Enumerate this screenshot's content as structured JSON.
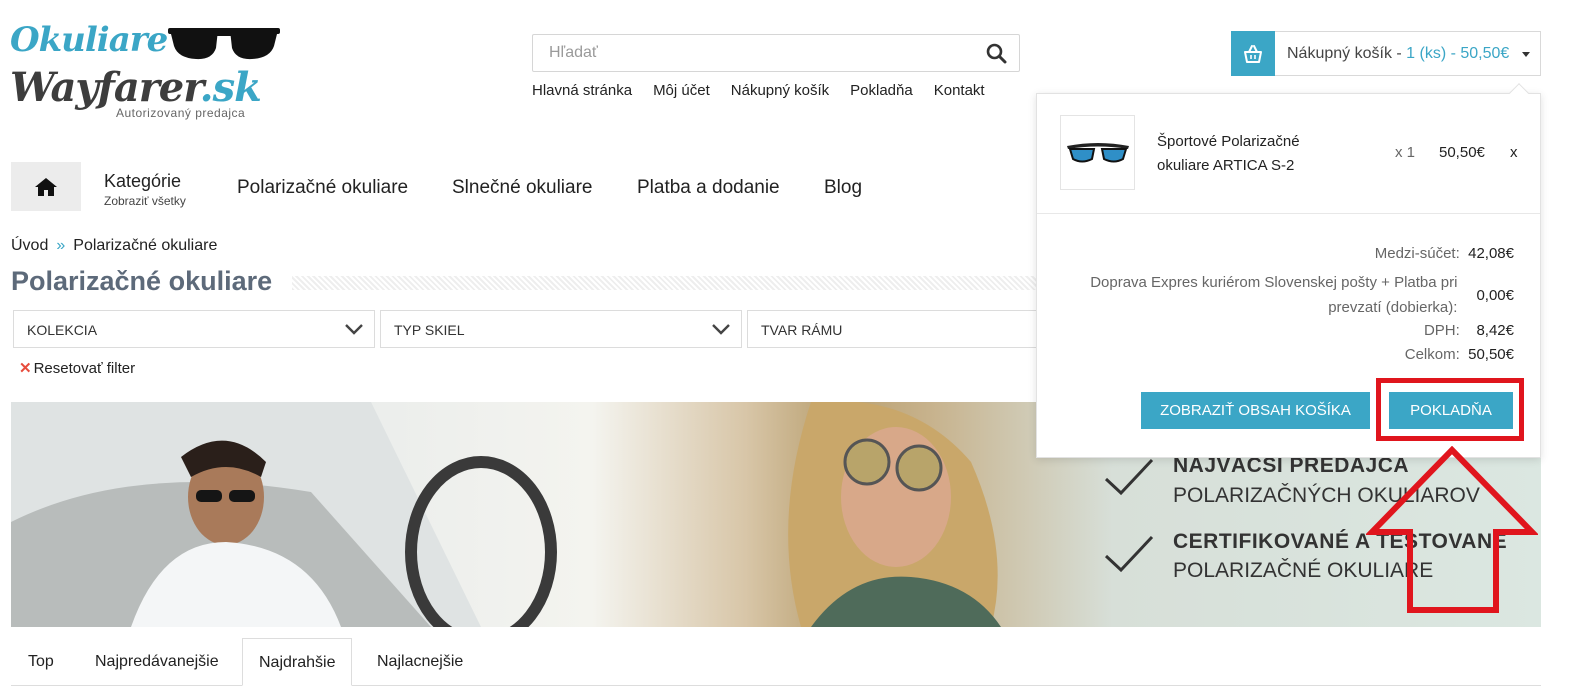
{
  "logo": {
    "line1": "Okuliare",
    "line2_main": "Wayfarer",
    "line2_domain": ".sk",
    "tagline": "Autorizovaný predajca"
  },
  "search": {
    "placeholder": "Hľadať",
    "icon": "search-icon"
  },
  "top_links": [
    "Hlavná stránka",
    "Môj účet",
    "Nákupný košík",
    "Pokladňa",
    "Kontakt"
  ],
  "cart": {
    "label": "Nákupný košík - ",
    "summary": "1 (ks) - 50,50€",
    "icon": "basket-icon"
  },
  "nav": {
    "home_icon": "home-icon",
    "categories_title": "Kategórie",
    "categories_sub": "Zobraziť všetky",
    "items": [
      "Polarizačné okuliare",
      "Slnečné okuliare",
      "Platba a dodanie",
      "Blog"
    ]
  },
  "breadcrumb": {
    "home": "Úvod",
    "separator": "»",
    "current": "Polarizačné okuliare"
  },
  "page_title": "Polarizačné okuliare",
  "filters": [
    "KOLEKCIA",
    "TYP SKIEL",
    "TVAR RÁMU"
  ],
  "reset_filter": "Resetovať filter",
  "banner": {
    "line1": "NAJVÄČŠÍ PREDAJCA",
    "line2": "POLARIZAČNÝCH OKULIAROV",
    "line3": "CERTIFIKOVANÉ A TESTOVANÉ",
    "line4": "POLARIZAČNÉ OKULIARE"
  },
  "sort_tabs": [
    "Top",
    "Najpredávanejšie",
    "Najdrahšie",
    "Najlacnejšie"
  ],
  "active_tab": "Najdrahšie",
  "cart_dropdown": {
    "item": {
      "name": "Športové Polarizačné okuliare ARTICA S-2",
      "qty": "x 1",
      "price": "50,50€",
      "remove": "x"
    },
    "subtotal_label": "Medzi-súčet:",
    "subtotal": "42,08€",
    "shipping_label": "Doprava Expres kuriérom Slovenskej pošty + Platba pri prevzatí (dobierka):",
    "shipping": "0,00€",
    "vat_label": "DPH:",
    "vat": "8,42€",
    "total_label": "Celkom:",
    "total": "50,50€",
    "view_cart_button": "ZOBRAZIŤ OBSAH KOŠÍKA",
    "checkout_button": "POKLADŇA"
  },
  "colors": {
    "accent": "#3ba6c6",
    "annotation": "#e0151d",
    "title": "#5d6a7a"
  }
}
